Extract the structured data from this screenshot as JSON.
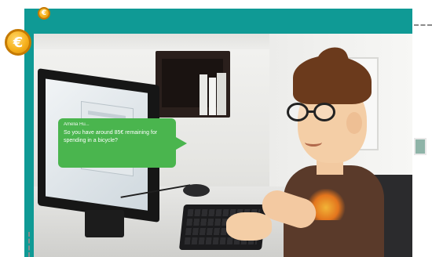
{
  "header": {
    "coin_small_symbol": "€",
    "coin_large_symbol": "€",
    "bar_color": "#0f9a95",
    "coin_color": "#f6b11d"
  },
  "dialogue": {
    "speaker": "Amelia Hu...",
    "message": "So you have around 85€ remaining for spending in a bicycle?",
    "bubble_color": "#4ab54e"
  },
  "toolbar": {
    "items": [
      {
        "icon": "menu-icon"
      },
      {
        "icon": "refresh-icon",
        "glyph": "↻"
      },
      {
        "icon": "chat-icon"
      },
      {
        "icon": "calculator-icon"
      },
      {
        "icon": "info-icon",
        "glyph": "I"
      }
    ]
  }
}
